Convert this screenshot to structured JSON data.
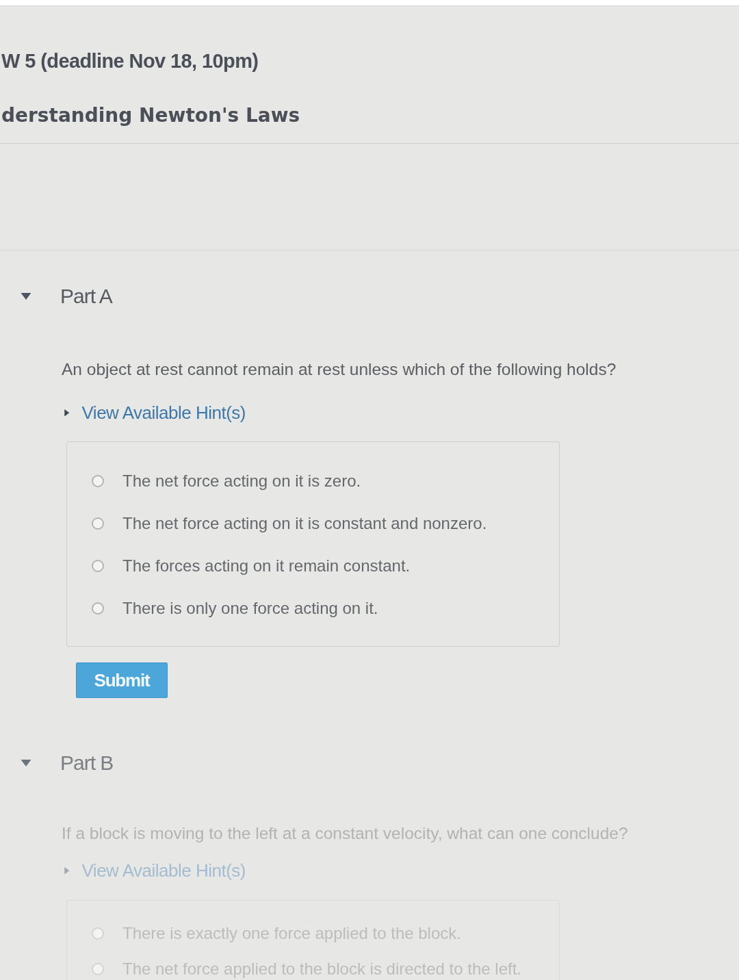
{
  "header": {
    "assignment_title": "W 5 (deadline Nov 18, 10pm)",
    "item_title": "derstanding Newton's Laws"
  },
  "parts": [
    {
      "label": "Part A",
      "expanded": true,
      "disabled": false,
      "question": "An object at rest cannot remain at rest unless which of the following holds?",
      "hint": {
        "label": "View Available Hint(s)",
        "expanded": false
      },
      "options": [
        {
          "text": "The net force acting on it is zero.",
          "selected": false
        },
        {
          "text": "The net force acting on it is constant and nonzero.",
          "selected": false
        },
        {
          "text": "The forces acting on it remain constant.",
          "selected": false
        },
        {
          "text": "There is only one force acting on it.",
          "selected": false
        }
      ],
      "submit": "Submit"
    },
    {
      "label": "Part B",
      "expanded": true,
      "disabled": true,
      "question": "If a block is moving to the left at a constant velocity, what can one conclude?",
      "hint": {
        "label": "View Available Hint(s)",
        "expanded": false
      },
      "options": [
        {
          "text": "There is exactly one force applied to the block.",
          "selected": false
        },
        {
          "text": "The net force applied to the block is directed to the left.",
          "selected": false
        }
      ]
    }
  ]
}
